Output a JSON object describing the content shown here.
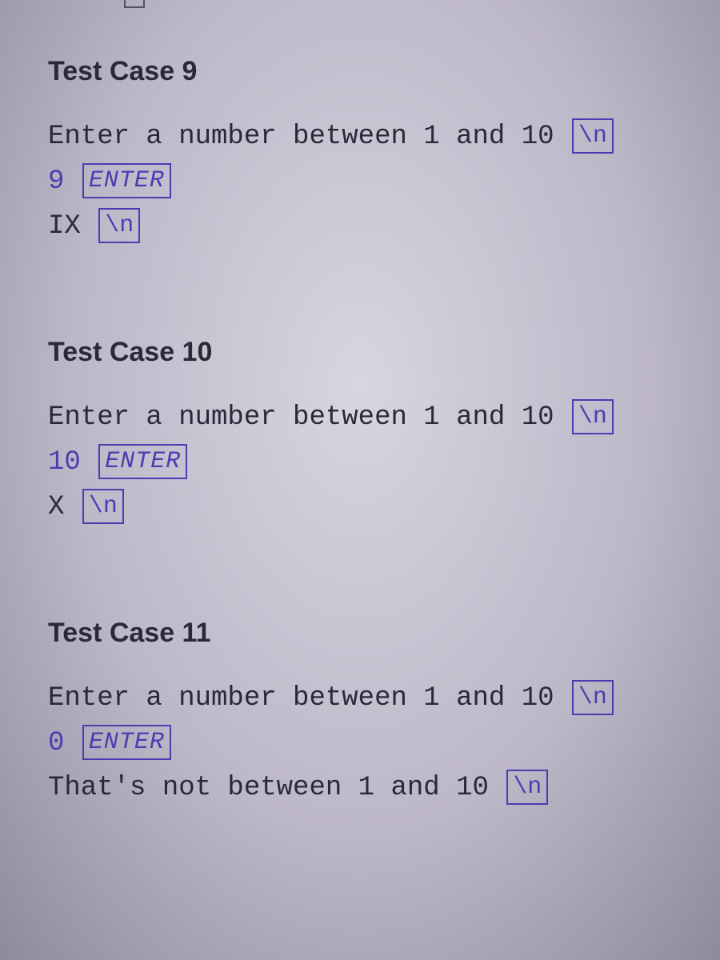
{
  "badges": {
    "newline": "\\n",
    "enter": "ENTER"
  },
  "test_cases": [
    {
      "title": "Test Case 9",
      "prompt": "Enter a number between 1 and 10",
      "input": "9",
      "output": "IX"
    },
    {
      "title": "Test Case 10",
      "prompt": "Enter a number between 1 and 10",
      "input": "10",
      "output": "X"
    },
    {
      "title": "Test Case 11",
      "prompt": "Enter a number between 1 and 10",
      "input": "0",
      "output": "That's not between 1 and 10"
    }
  ]
}
